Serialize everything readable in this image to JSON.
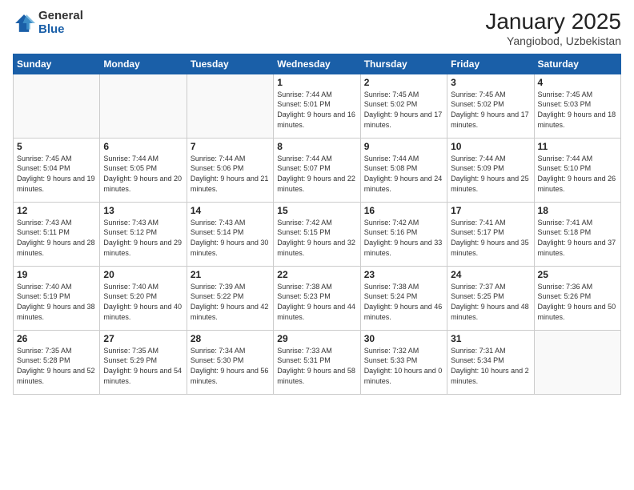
{
  "header": {
    "logo": {
      "general": "General",
      "blue": "Blue"
    },
    "month": "January 2025",
    "location": "Yangiobod, Uzbekistan"
  },
  "days_of_week": [
    "Sunday",
    "Monday",
    "Tuesday",
    "Wednesday",
    "Thursday",
    "Friday",
    "Saturday"
  ],
  "weeks": [
    [
      {
        "day": "",
        "empty": true
      },
      {
        "day": "",
        "empty": true
      },
      {
        "day": "",
        "empty": true
      },
      {
        "day": "1",
        "sunrise": "7:44 AM",
        "sunset": "5:01 PM",
        "daylight": "9 hours and 16 minutes."
      },
      {
        "day": "2",
        "sunrise": "7:45 AM",
        "sunset": "5:02 PM",
        "daylight": "9 hours and 17 minutes."
      },
      {
        "day": "3",
        "sunrise": "7:45 AM",
        "sunset": "5:02 PM",
        "daylight": "9 hours and 17 minutes."
      },
      {
        "day": "4",
        "sunrise": "7:45 AM",
        "sunset": "5:03 PM",
        "daylight": "9 hours and 18 minutes."
      }
    ],
    [
      {
        "day": "5",
        "sunrise": "7:45 AM",
        "sunset": "5:04 PM",
        "daylight": "9 hours and 19 minutes."
      },
      {
        "day": "6",
        "sunrise": "7:44 AM",
        "sunset": "5:05 PM",
        "daylight": "9 hours and 20 minutes."
      },
      {
        "day": "7",
        "sunrise": "7:44 AM",
        "sunset": "5:06 PM",
        "daylight": "9 hours and 21 minutes."
      },
      {
        "day": "8",
        "sunrise": "7:44 AM",
        "sunset": "5:07 PM",
        "daylight": "9 hours and 22 minutes."
      },
      {
        "day": "9",
        "sunrise": "7:44 AM",
        "sunset": "5:08 PM",
        "daylight": "9 hours and 24 minutes."
      },
      {
        "day": "10",
        "sunrise": "7:44 AM",
        "sunset": "5:09 PM",
        "daylight": "9 hours and 25 minutes."
      },
      {
        "day": "11",
        "sunrise": "7:44 AM",
        "sunset": "5:10 PM",
        "daylight": "9 hours and 26 minutes."
      }
    ],
    [
      {
        "day": "12",
        "sunrise": "7:43 AM",
        "sunset": "5:11 PM",
        "daylight": "9 hours and 28 minutes."
      },
      {
        "day": "13",
        "sunrise": "7:43 AM",
        "sunset": "5:12 PM",
        "daylight": "9 hours and 29 minutes."
      },
      {
        "day": "14",
        "sunrise": "7:43 AM",
        "sunset": "5:14 PM",
        "daylight": "9 hours and 30 minutes."
      },
      {
        "day": "15",
        "sunrise": "7:42 AM",
        "sunset": "5:15 PM",
        "daylight": "9 hours and 32 minutes."
      },
      {
        "day": "16",
        "sunrise": "7:42 AM",
        "sunset": "5:16 PM",
        "daylight": "9 hours and 33 minutes."
      },
      {
        "day": "17",
        "sunrise": "7:41 AM",
        "sunset": "5:17 PM",
        "daylight": "9 hours and 35 minutes."
      },
      {
        "day": "18",
        "sunrise": "7:41 AM",
        "sunset": "5:18 PM",
        "daylight": "9 hours and 37 minutes."
      }
    ],
    [
      {
        "day": "19",
        "sunrise": "7:40 AM",
        "sunset": "5:19 PM",
        "daylight": "9 hours and 38 minutes."
      },
      {
        "day": "20",
        "sunrise": "7:40 AM",
        "sunset": "5:20 PM",
        "daylight": "9 hours and 40 minutes."
      },
      {
        "day": "21",
        "sunrise": "7:39 AM",
        "sunset": "5:22 PM",
        "daylight": "9 hours and 42 minutes."
      },
      {
        "day": "22",
        "sunrise": "7:38 AM",
        "sunset": "5:23 PM",
        "daylight": "9 hours and 44 minutes."
      },
      {
        "day": "23",
        "sunrise": "7:38 AM",
        "sunset": "5:24 PM",
        "daylight": "9 hours and 46 minutes."
      },
      {
        "day": "24",
        "sunrise": "7:37 AM",
        "sunset": "5:25 PM",
        "daylight": "9 hours and 48 minutes."
      },
      {
        "day": "25",
        "sunrise": "7:36 AM",
        "sunset": "5:26 PM",
        "daylight": "9 hours and 50 minutes."
      }
    ],
    [
      {
        "day": "26",
        "sunrise": "7:35 AM",
        "sunset": "5:28 PM",
        "daylight": "9 hours and 52 minutes."
      },
      {
        "day": "27",
        "sunrise": "7:35 AM",
        "sunset": "5:29 PM",
        "daylight": "9 hours and 54 minutes."
      },
      {
        "day": "28",
        "sunrise": "7:34 AM",
        "sunset": "5:30 PM",
        "daylight": "9 hours and 56 minutes."
      },
      {
        "day": "29",
        "sunrise": "7:33 AM",
        "sunset": "5:31 PM",
        "daylight": "9 hours and 58 minutes."
      },
      {
        "day": "30",
        "sunrise": "7:32 AM",
        "sunset": "5:33 PM",
        "daylight": "10 hours and 0 minutes."
      },
      {
        "day": "31",
        "sunrise": "7:31 AM",
        "sunset": "5:34 PM",
        "daylight": "10 hours and 2 minutes."
      },
      {
        "day": "",
        "empty": true
      }
    ]
  ]
}
